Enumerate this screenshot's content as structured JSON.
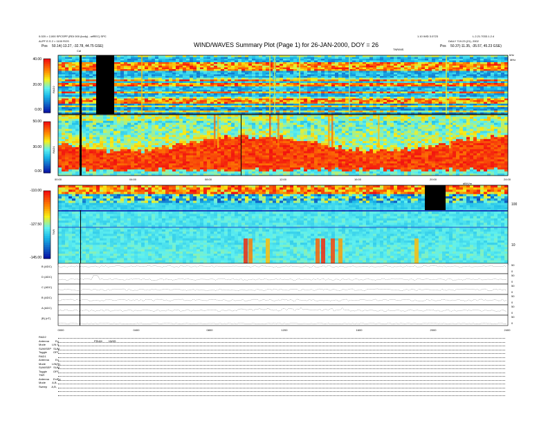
{
  "header": {
    "left_line1": "0.020 > 2,000 SPCSPP (RDI 000 (loofy) - wiREC) SPC",
    "left_line2": "ALPF E.S 2 > 1100 ROS",
    "pos_left_label": "Pos",
    "pos_left_value": "50.14(-13.27, -32.78, 44.75 GSE)",
    "title": "WIND/WAVES Summary Plot (Page 1) for 26-JAN-2000, DOY = 26",
    "right_line1": "1.10 WID 3.0723",
    "right_line1b": "L.2.21.7033.1.2.4",
    "right_line2": "DAILY 719.23 (21), 2002",
    "pos_right_label": "Pos",
    "pos_right_value": "50.37(-11.35, -35.57, 45.23 GSE)",
    "cal_mark": "Cal",
    "tnr_label": "TNR/MS",
    "hz_label": "kHz",
    "dbvolt_label": "dB/V/m"
  },
  "colors": {
    "low": "#0a18a8",
    "mid": "#19b8e8",
    "cyan": "#5ff0f0",
    "yellow": "#f6ef18",
    "orange": "#ff8a00",
    "red": "#f21010",
    "gap": "#000000"
  },
  "chart_data": [
    {
      "type": "heatmap",
      "name": "RAD2",
      "ylabel": "RAD2",
      "colorbar_ticks": [
        "40.00",
        "20.00",
        "0.00"
      ],
      "right_unit": "MHz",
      "x": "Time 00:00 - 24:00 UT",
      "character": "mostly blue background with horizontal red/yellow interference bands; black gap 02:20-03:10"
    },
    {
      "type": "heatmap",
      "name": "RAD1",
      "ylabel": "RAD1",
      "colorbar_ticks": [
        "50.00",
        "30.00",
        "0.00"
      ],
      "character": "continuous red band in lower half across the day with cyan/blue above",
      "x_tick_labels": [
        "00:00",
        "04:00",
        "08:00",
        "12:00",
        "16:00",
        "20:00",
        "24:00"
      ]
    },
    {
      "type": "heatmap",
      "name": "TNR",
      "ylabel": "TNR",
      "colorbar_ticks": [
        "-110.00",
        "-127.50",
        "-145.00"
      ],
      "right_ticks": [
        "100",
        "10"
      ],
      "x_tick_labels": [
        "00:00",
        "04:00",
        "08:00",
        "12:00",
        "16:00",
        "20:00",
        "24:00"
      ]
    },
    {
      "type": "line",
      "name": "Field time series",
      "rows": [
        {
          "label": "B (ADC)",
          "scale": [
            "50",
            "0"
          ]
        },
        {
          "label": "D (ADC)",
          "scale": [
            "50",
            "0"
          ]
        },
        {
          "label": "C (ADC)",
          "scale": [
            "50",
            "0"
          ]
        },
        {
          "label": "B (ADC)",
          "scale": [
            "50",
            "0"
          ]
        },
        {
          "label": "A (ADC)",
          "scale": [
            "50",
            "0"
          ]
        },
        {
          "label": "|B| (nT)",
          "scale": [
            "50",
            "0"
          ]
        }
      ],
      "x_tick_labels": [
        "0000",
        "0400",
        "0800",
        "1200",
        "1600",
        "2000",
        "2400"
      ]
    }
  ],
  "params": {
    "rad2": {
      "title": "RAD2",
      "rows": [
        [
          "Antenna",
          "Ey"
        ],
        [
          "Mode",
          "LIN S"
        ],
        [
          "SUM/SEP",
          "SUM"
        ],
        [
          "Toggle",
          "OFF"
        ]
      ]
    },
    "rad1": {
      "title": "RAD1",
      "rows": [
        [
          "Antenna",
          "Ex"
        ],
        [
          "Mode",
          "LIN(S)"
        ],
        [
          "SUM/SEP",
          "SUM"
        ],
        [
          "Toggle",
          "OFF"
        ]
      ]
    },
    "tnr": {
      "title": "TNR",
      "rows": [
        [
          "Antenna",
          "Ex/Ey"
        ],
        [
          "Mode",
          "A,B,"
        ],
        [
          "Sweep",
          "A,B,"
        ]
      ]
    },
    "note_label": "PSUM",
    "note_value": "1W0S"
  }
}
